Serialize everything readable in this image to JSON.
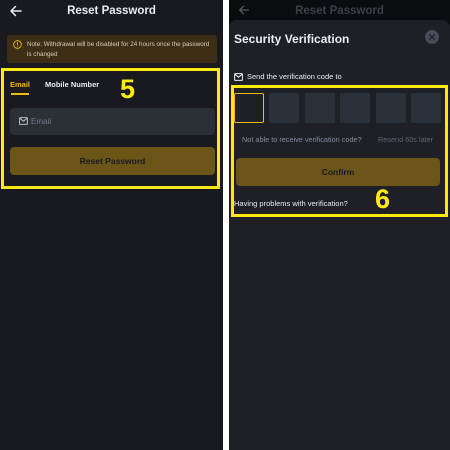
{
  "reset_screen": {
    "title": "Reset Password",
    "notice": "Note: Withdrawal will be disabled for 24 hours once the password is changed",
    "tabs": [
      {
        "label": "Email",
        "active": true
      },
      {
        "label": "Mobile Number",
        "active": false
      }
    ],
    "email_placeholder": "Email",
    "reset_button": "Reset Password",
    "step_number": "5",
    "icons": {
      "back": "back-arrow-icon",
      "notice": "warning-circle-icon",
      "email": "mail-icon"
    }
  },
  "verification_sheet": {
    "background_title": "Reset Password",
    "title": "Security Verification",
    "send_label": "Send the verification code to",
    "code_box_count": 6,
    "not_received": "Not able to receive verification code?",
    "resend": "Resend 60s later",
    "confirm_button": "Confirm",
    "problems_link": "Having problems with verification?",
    "step_number": "6",
    "icons": {
      "close": "close-icon",
      "mail": "mail-icon"
    }
  },
  "colors": {
    "accent": "#f0b90b",
    "highlight": "#fde910",
    "button_disabled": "#6b5517",
    "background": "#181a20",
    "sheet": "#1e2026",
    "input": "#2b2f36"
  }
}
